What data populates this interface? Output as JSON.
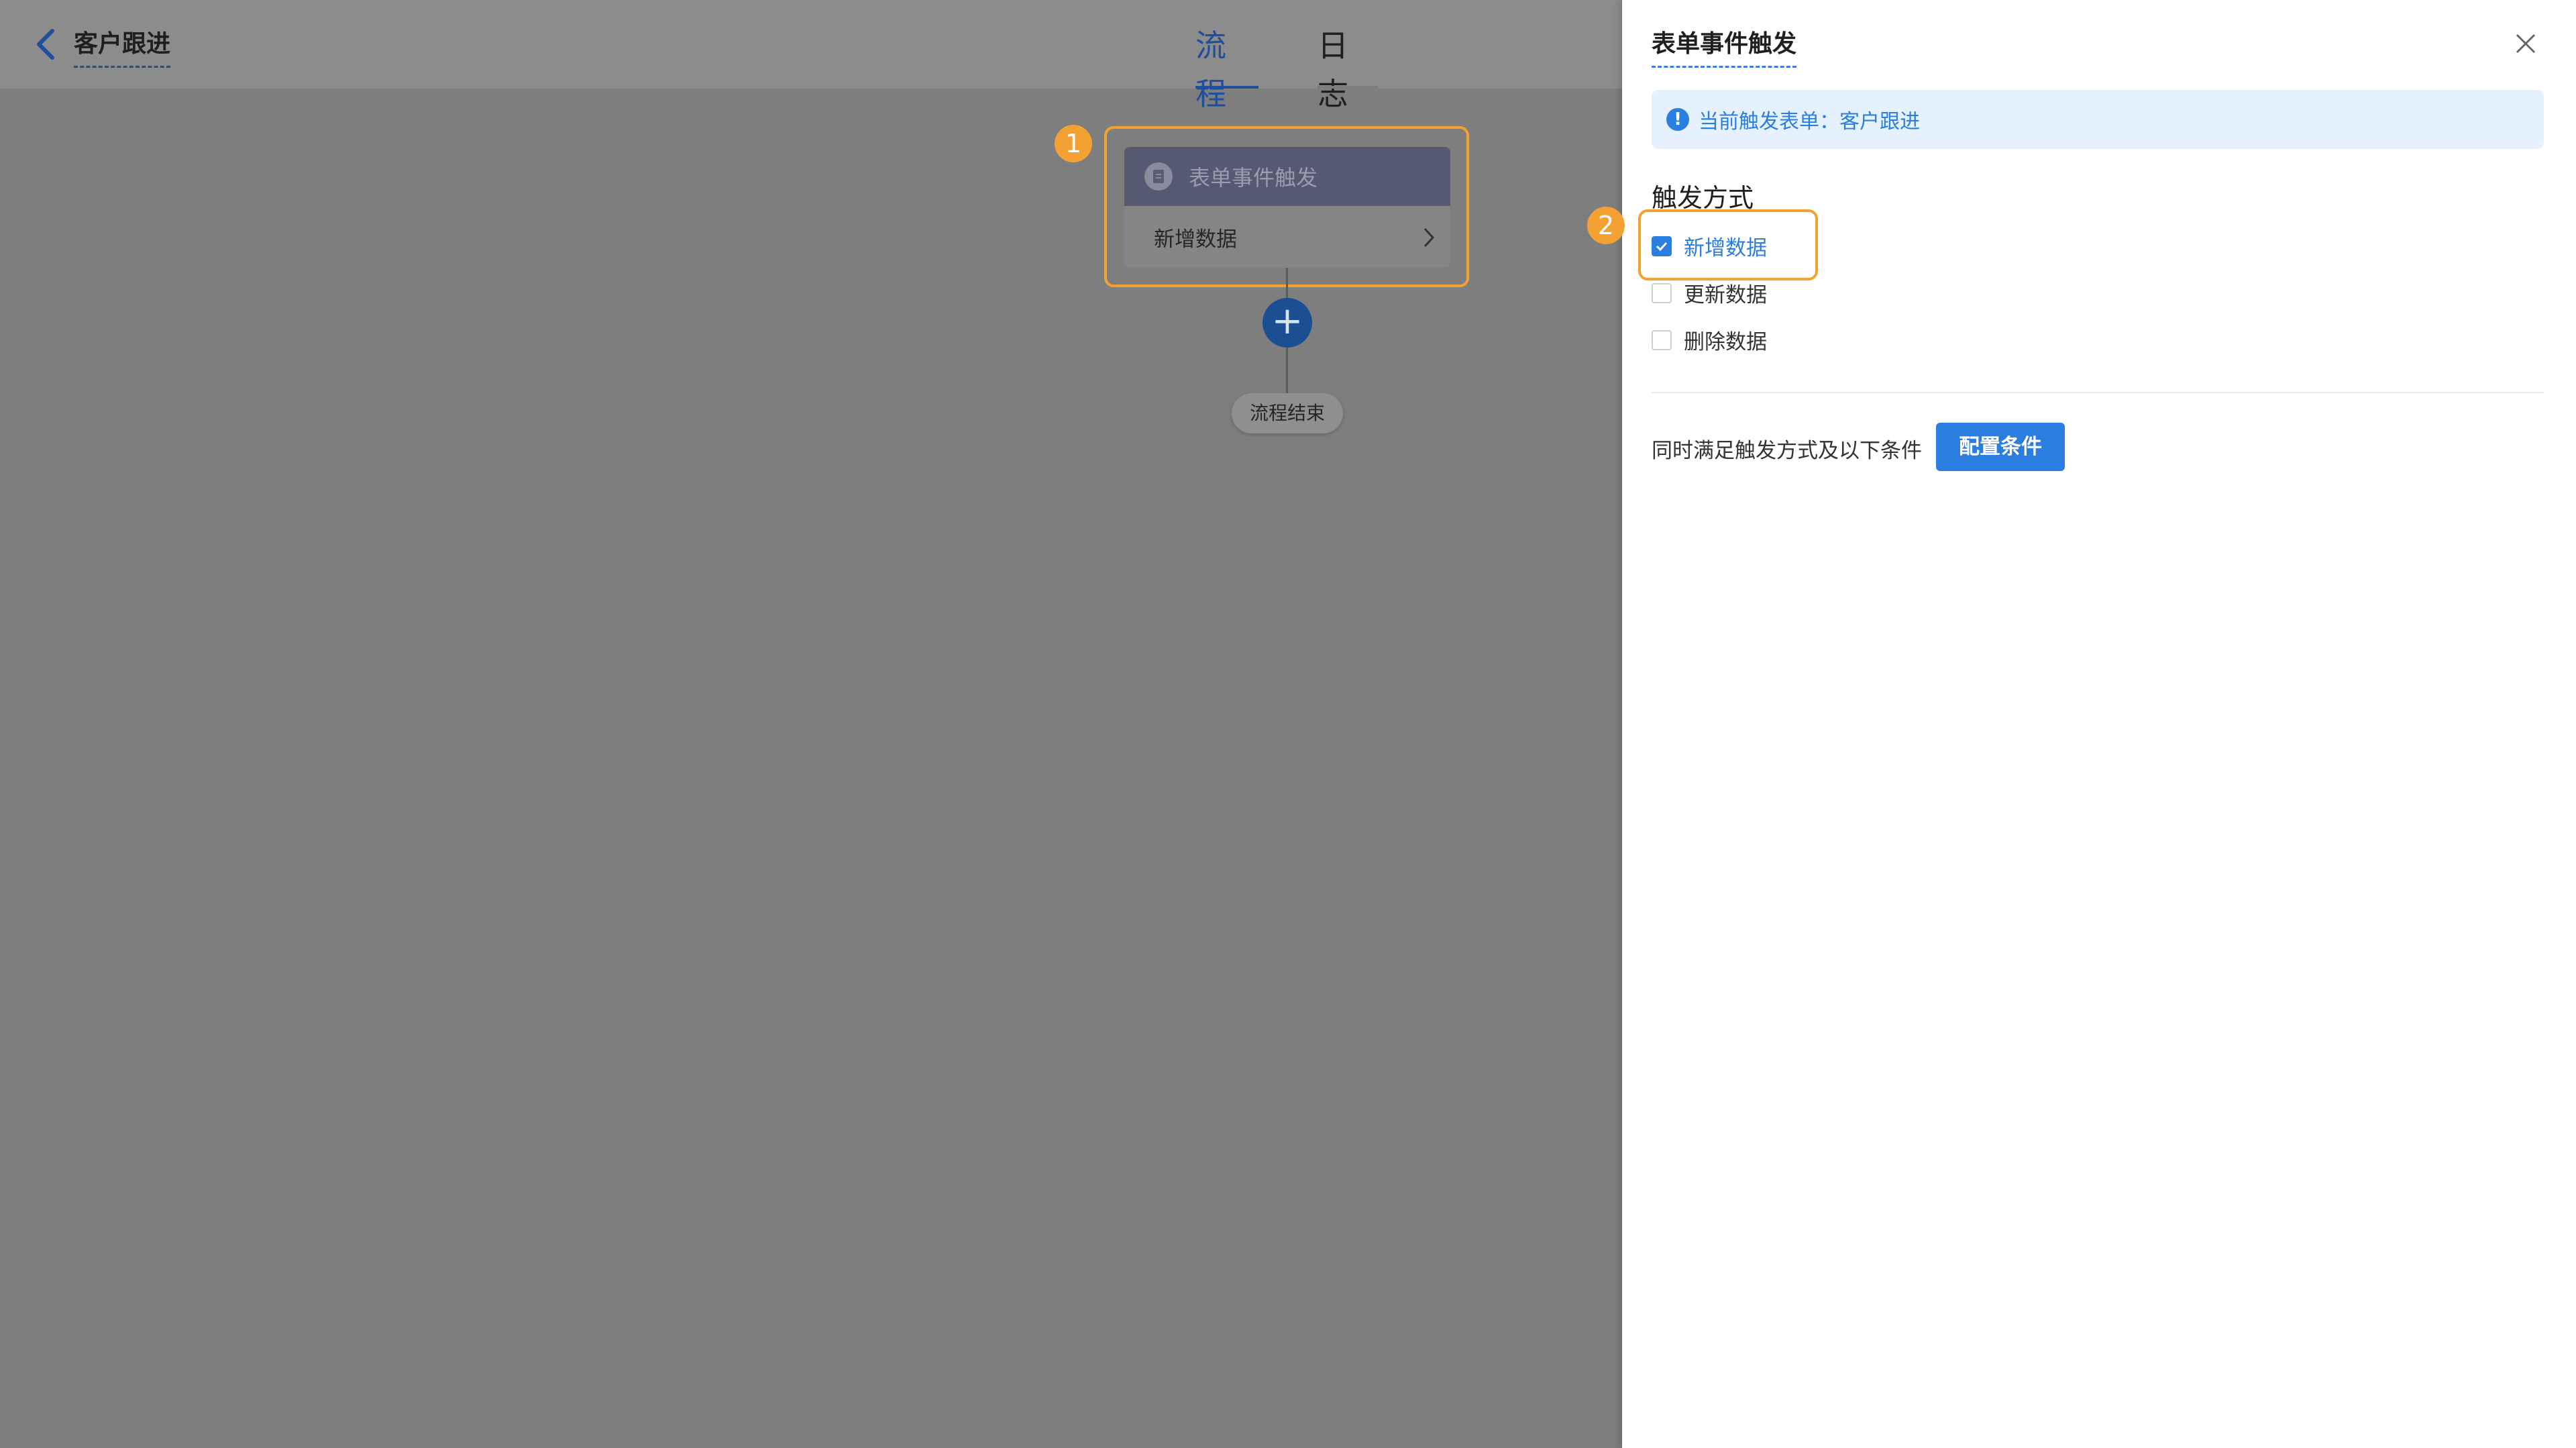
{
  "header": {
    "title": "客户跟进",
    "tabs": [
      {
        "label": "流程",
        "active": true
      },
      {
        "label": "日志",
        "active": false
      }
    ]
  },
  "flow": {
    "node": {
      "title": "表单事件触发",
      "subtitle": "新增数据"
    },
    "end_label": "流程结束",
    "annotation_1": "1"
  },
  "panel": {
    "title": "表单事件触发",
    "info_label": "当前触发表单：",
    "info_value": "客户跟进",
    "trigger_section": "触发方式",
    "annotation_2": "2",
    "options": [
      {
        "label": "新增数据",
        "checked": true
      },
      {
        "label": "更新数据",
        "checked": false
      },
      {
        "label": "删除数据",
        "checked": false
      }
    ],
    "condition_text": "同时满足触发方式及以下条件",
    "config_button": "配置条件"
  },
  "colors": {
    "accent": "#2a7ee0",
    "highlight": "#f3a133",
    "overlay": "#7e7e7e"
  }
}
